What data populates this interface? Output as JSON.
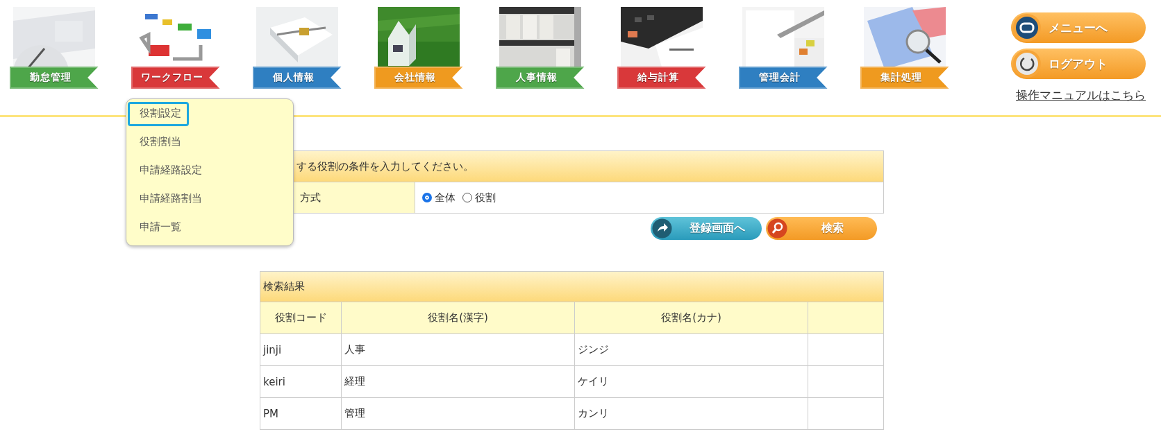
{
  "nav": [
    {
      "label": "勤怠管理",
      "color": "#4ea64a",
      "kind": "picture"
    },
    {
      "label": "ワークフロー",
      "color": "#d9383a",
      "kind": "picture",
      "expanded": true
    },
    {
      "label": "個人情報",
      "color": "#2f7fc1",
      "kind": "picture"
    },
    {
      "label": "会社情報",
      "color": "#ef9a1f",
      "kind": "picture"
    },
    {
      "label": "人事情報",
      "color": "#4ea64a",
      "kind": "picture"
    },
    {
      "label": "給与計算",
      "color": "#d9383a",
      "kind": "picture"
    },
    {
      "label": "管理会計",
      "color": "#2f7fc1",
      "kind": "picture"
    },
    {
      "label": "集計処理",
      "color": "#ef9a1f",
      "kind": "picture"
    }
  ],
  "header_buttons": [
    {
      "label": "メニューへ",
      "kind": "menu"
    },
    {
      "label": "ログアウト",
      "kind": "logout"
    }
  ],
  "manual_link": "操作マニュアルはこちら",
  "dropdown": [
    {
      "label": "役割設定",
      "selected": true
    },
    {
      "label": "役割割当",
      "selected": false
    },
    {
      "label": "申請経路設定",
      "selected": false
    },
    {
      "label": "申請経路割当",
      "selected": false
    },
    {
      "label": "申請一覧",
      "selected": false
    }
  ],
  "search_form": {
    "heading": "する役割の条件を入力してください。",
    "label": "方式",
    "options": [
      {
        "label": "全体",
        "selected": true
      },
      {
        "label": "役割",
        "selected": false
      }
    ],
    "buttons": [
      {
        "label": "登録画面へ",
        "kind": "register"
      },
      {
        "label": "検索",
        "kind": "search"
      }
    ]
  },
  "results": {
    "title": "検索結果",
    "columns": [
      "役割コード",
      "役割名(漢字)",
      "役割名(カナ)"
    ],
    "rows": [
      [
        "jinji",
        "人事",
        "ジンジ"
      ],
      [
        "keiri",
        "経理",
        "ケイリ"
      ],
      [
        "PM",
        "管理",
        "カンリ"
      ]
    ]
  }
}
